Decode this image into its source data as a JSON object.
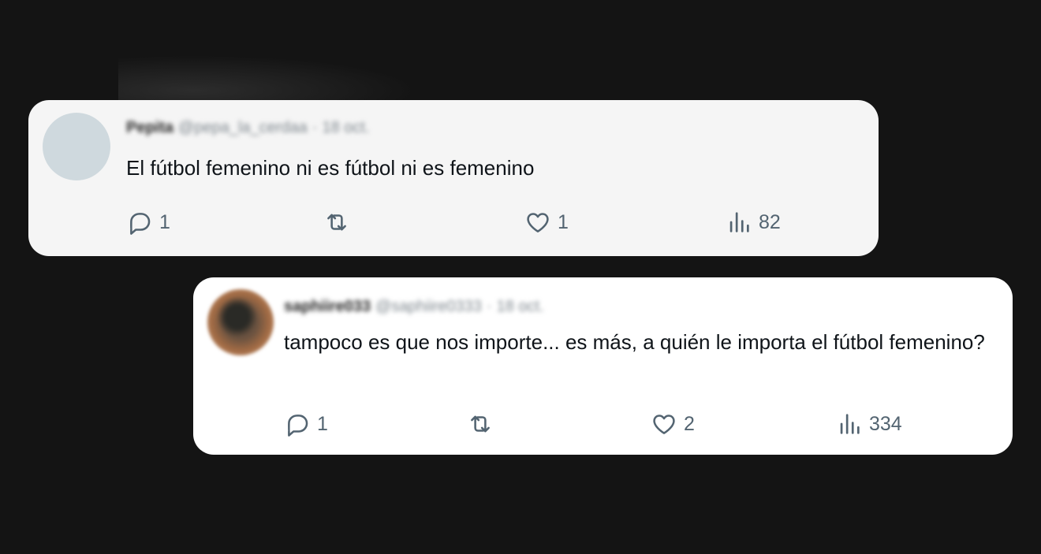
{
  "tweets": [
    {
      "author_name": "Pepita",
      "author_handle": "@pepa_la_cerdaa",
      "separator": "·",
      "date": "18 oct.",
      "text": "El fútbol femenino ni es fútbol ni es femenino",
      "replies": "1",
      "retweets": "",
      "likes": "1",
      "views": "82"
    },
    {
      "author_name": "saphiire033",
      "author_handle": "@saphiire0333",
      "separator": "·",
      "date": "18 oct.",
      "text": "tampoco es que nos importe... es más, a quién le importa el fútbol femenino?",
      "replies": "1",
      "retweets": "",
      "likes": "2",
      "views": "334"
    }
  ],
  "icons": {
    "reply": "reply-icon",
    "retweet": "retweet-icon",
    "like": "heart-icon",
    "views": "views-icon"
  },
  "colors": {
    "background": "#141414",
    "card_1": "#f5f5f5",
    "card_2": "#ffffff",
    "text": "#0f1419",
    "muted": "#536471"
  }
}
